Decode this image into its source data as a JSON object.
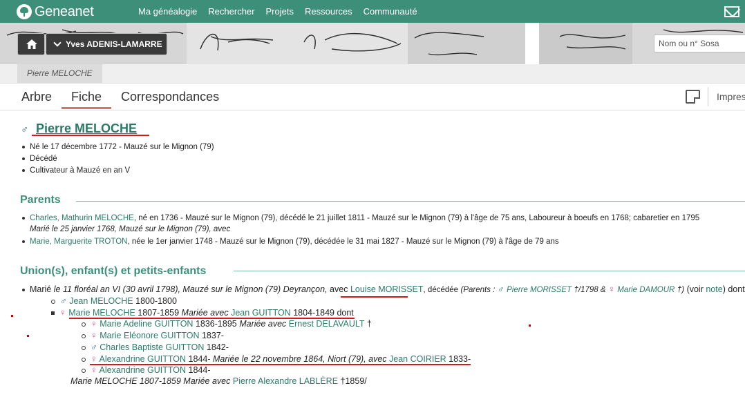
{
  "topnav": {
    "logo": "Geneanet",
    "links": [
      "Ma généalogie",
      "Rechercher",
      "Projets",
      "Ressources",
      "Communauté"
    ]
  },
  "banner": {
    "user": "Yves ADENIS-LAMARRE",
    "search_placeholder": "Nom ou n° Sosa"
  },
  "breadcrumb": "Pierre MELOCHE",
  "tabs": [
    "Arbre",
    "Fiche",
    "Correspondances"
  ],
  "print_label": "Impres",
  "person": {
    "symbol": "♂",
    "name": "Pierre MELOCHE",
    "facts": [
      "Né le 17 décembre 1772 - Mauzé sur le Mignon (79)",
      "Décédé",
      "Cultivateur à Mauzé en an V"
    ]
  },
  "parents": {
    "title": "Parents",
    "father_name": "Charles, Mathurin MELOCHE",
    "father_details": ", né en 1736 - Mauzé sur le Mignon (79), décédé le 21 juillet 1811 - Mauzé sur le Mignon (79) à l'âge de 75 ans, Laboureur à boeufs en 1768; cabaretier en 1795",
    "marriage": "Marié le 25 janvier 1768, Mauzé sur le Mignon (79), avec",
    "mother_name": "Marie, Marguerite TROTON",
    "mother_details": ", née le 1er janvier 1748 - Mauzé sur le Mignon (79), décédée le 31 mai 1827 - Mauzé sur le Mignon (79) à l'âge de 79 ans"
  },
  "unions": {
    "title": "Union(s), enfant(s) et petits-enfants",
    "marie_prefix": "Marié",
    "marie_date": "le 11 floréal an VI (30 avril 1798), Mauzé sur le Mignon (79) Deyrançon,",
    "avec": "avec",
    "spouse": "Louise MORISSET",
    "spouse_died": ", décédée",
    "parents_label": "(Parents :",
    "spouse_father": "Pierre MORISSET",
    "spouse_father_note": "†/1798 &",
    "spouse_mother": "Marie DAMOUR",
    "spouse_mother_note": "†)",
    "voir": "(voir",
    "note": "note",
    "dont": ") dont",
    "child1_name": "Jean MELOCHE",
    "child1_dates": "1800-1800",
    "child2_name": "Marie MELOCHE",
    "child2_dates": "1807-1859",
    "child2_mariee": "Mariée avec",
    "child2_spouse": "Jean GUITTON",
    "child2_spouse_dates": "1804-1849 dont",
    "gc": [
      {
        "sex": "f",
        "name": "Marie Adeline GUITTON",
        "dates": "1836-1895",
        "extra_it": "Mariée avec",
        "spouse": "Ernest DELAVAULT",
        "tail": "†"
      },
      {
        "sex": "f",
        "name": "Marie Eléonore GUITTON",
        "dates": "1837-",
        "extra_it": "",
        "spouse": "",
        "tail": ""
      },
      {
        "sex": "m",
        "name": "Charles Baptiste GUITTON",
        "dates": "1842-",
        "extra_it": "",
        "spouse": "",
        "tail": ""
      },
      {
        "sex": "f",
        "name": "Alexandrine GUITTON",
        "dates": "1844-",
        "extra_it": "Mariée le 22 novembre 1864, Niort (79), avec",
        "spouse": "Jean COIRIER",
        "tail": "1833-"
      },
      {
        "sex": "f",
        "name": "Alexandrine GUITTON",
        "dates": "1844-",
        "extra_it": "",
        "spouse": "",
        "tail": ""
      }
    ],
    "last_line_it1": "Marie MELOCHE 1807-1859",
    "last_line_it2": "Mariée avec",
    "last_line_spouse": "Pierre Alexandre LABLÈRE",
    "last_line_tail": "†1859/"
  },
  "colors": {
    "nav_bg": "#3d8f7a",
    "link": "#2b7a67",
    "annotation_red": "#d21a1a"
  }
}
